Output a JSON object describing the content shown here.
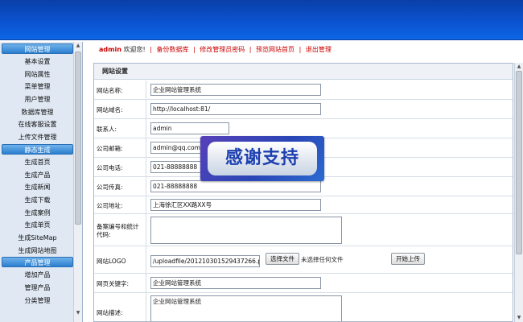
{
  "sidebar": {
    "groups": [
      {
        "title": "网站管理",
        "items": [
          "基本设置",
          "网站属性",
          "菜单管理",
          "用户管理",
          "数据库管理",
          "在线客服设置",
          "上传文件管理"
        ]
      },
      {
        "title": "静态生成",
        "items": [
          "生成首页",
          "生成产品",
          "生成新闻",
          "生成下载",
          "生成案例",
          "生成单页",
          "生成SiteMap",
          "生成网站地图"
        ]
      },
      {
        "title": "产品管理",
        "items": [
          "增加产品",
          "管理产品",
          "分类管理"
        ]
      }
    ]
  },
  "topnav": {
    "user": "admin",
    "welcome": " 欢迎您!",
    "links": [
      "备份数据库",
      "修改管理员密码",
      "预览网站首页",
      "退出管理"
    ]
  },
  "panel": {
    "title": "网站设置",
    "fields": {
      "site_name": {
        "label": "网站名称:",
        "value": "企业网站管理系统"
      },
      "domain": {
        "label": "网站域名:",
        "value": "http://localhost:81/"
      },
      "contact": {
        "label": "联系人:",
        "value": "admin"
      },
      "email": {
        "label": "公司邮箱:",
        "value": "admin@qq.com"
      },
      "phone": {
        "label": "公司电话:",
        "value": "021-88888888"
      },
      "fax": {
        "label": "公司传真:",
        "value": "021-88888888"
      },
      "address": {
        "label": "公司地址:",
        "value": "上海徐汇区XX路XX号"
      },
      "icp": {
        "label": "备案编号和统计代码:",
        "value": ""
      },
      "logo": {
        "label": "网站LOGO",
        "value": "/uploadfile/201210301529437266.png",
        "choose_button": "选择文件",
        "no_file": "未选择任何文件",
        "upload_button": "开始上传"
      },
      "keywords": {
        "label": "网页关键字:",
        "value": "企业网站管理系统"
      },
      "description": {
        "label": "网站描述:",
        "value": "企业网站管理系统"
      }
    }
  },
  "watermark": {
    "text": "感谢支持"
  }
}
